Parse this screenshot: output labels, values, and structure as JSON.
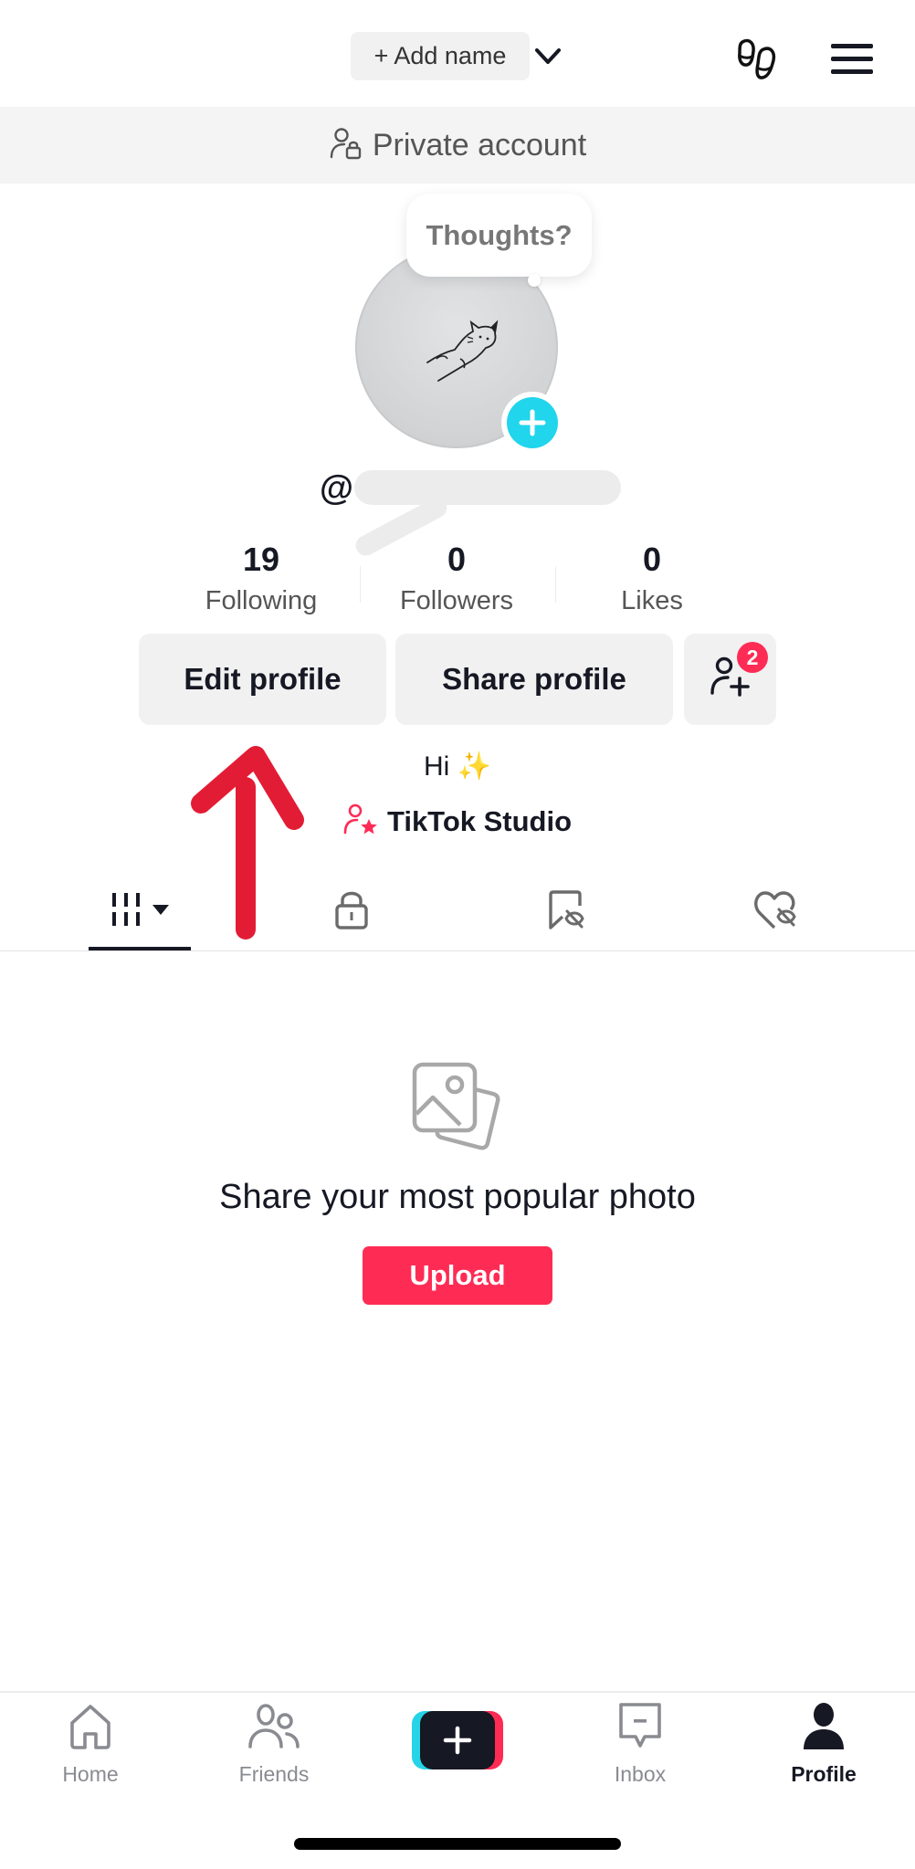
{
  "header": {
    "add_name_label": "+ Add name",
    "icons": [
      "chevron-down-icon",
      "footprints-icon",
      "menu-icon"
    ]
  },
  "private_banner": {
    "label": "Private account",
    "icon": "private-account-icon"
  },
  "profile": {
    "thought_bubble": "Thoughts?",
    "username_prefix": "@",
    "username_redacted": true,
    "bio": "Hi ✨",
    "studio_link": "TikTok Studio"
  },
  "stats": [
    {
      "value": "19",
      "label": "Following"
    },
    {
      "value": "0",
      "label": "Followers"
    },
    {
      "value": "0",
      "label": "Likes"
    }
  ],
  "actions": {
    "edit_profile": "Edit profile",
    "share_profile": "Share profile",
    "add_friends_badge": "2"
  },
  "tabs": [
    {
      "name": "videos-grid",
      "active": true
    },
    {
      "name": "private",
      "active": false
    },
    {
      "name": "favorites-hidden",
      "active": false
    },
    {
      "name": "liked-hidden",
      "active": false
    }
  ],
  "empty_state": {
    "headline": "Share your most popular photo",
    "button": "Upload"
  },
  "annotation": {
    "type": "arrow",
    "color": "#e31c35",
    "points_to": "Edit profile"
  },
  "bottom_nav": [
    {
      "label": "Home",
      "active": false
    },
    {
      "label": "Friends",
      "active": false
    },
    {
      "label": "",
      "icon": "create-icon",
      "active": false
    },
    {
      "label": "Inbox",
      "active": false
    },
    {
      "label": "Profile",
      "active": true
    }
  ],
  "colors": {
    "brand_red": "#fe2c55",
    "brand_cyan": "#25d4e6",
    "text_primary": "#161823",
    "button_bg": "#f1f1f2"
  }
}
